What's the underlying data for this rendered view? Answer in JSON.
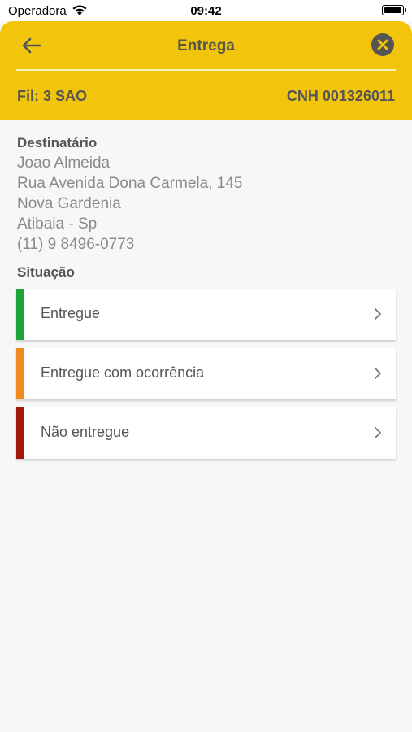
{
  "status_bar": {
    "carrier": "Operadora",
    "time": "09:42"
  },
  "header": {
    "title": "Entrega",
    "branch": "Fil: 3 SAO",
    "cnh": "CNH 001326011",
    "accent_color": "#f2c50a"
  },
  "recipient": {
    "label": "Destinatário",
    "name": "Joao Almeida",
    "street": "Rua Avenida Dona Carmela, 145",
    "district": "Nova Gardenia",
    "city": "Atibaia - Sp",
    "phone": "(11) 9 8496-0773"
  },
  "situation": {
    "label": "Situação",
    "options": [
      {
        "label": "Entregue",
        "color": "#1ea33a"
      },
      {
        "label": "Entregue com ocorrência",
        "color": "#f08a1c"
      },
      {
        "label": "Não entregue",
        "color": "#a3170f"
      }
    ]
  },
  "icons": [
    "arrow-left-icon",
    "close-icon",
    "chevron-right-icon",
    "wifi-icon",
    "battery-icon"
  ]
}
